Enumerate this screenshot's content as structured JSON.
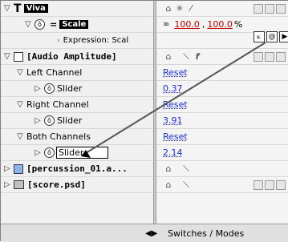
{
  "layers": {
    "viva": {
      "name": "Viva"
    },
    "scale": {
      "name": "Scale",
      "value_x": "100.0",
      "value_y": "100.0",
      "unit": "%",
      "expression_label": "Expression: Scal"
    },
    "audio": {
      "name": "[Audio Amplitude]"
    },
    "left": {
      "name": "Left Channel",
      "slider_label": "Slider",
      "reset": "Reset",
      "value": "0.37"
    },
    "right": {
      "name": "Right Channel",
      "slider_label": "Slider",
      "reset": "Reset",
      "value": "3.91"
    },
    "both": {
      "name": "Both Channels",
      "slider_label": "Slider",
      "reset": "Reset",
      "value": "2.14"
    },
    "percussion": {
      "name": "[percussion_01.a..."
    },
    "score": {
      "name": "[score.psd]"
    }
  },
  "footer": {
    "label": "Switches / Modes"
  },
  "colors": {
    "accent_link": "#1c2fd0",
    "value_red": "#c00000"
  }
}
